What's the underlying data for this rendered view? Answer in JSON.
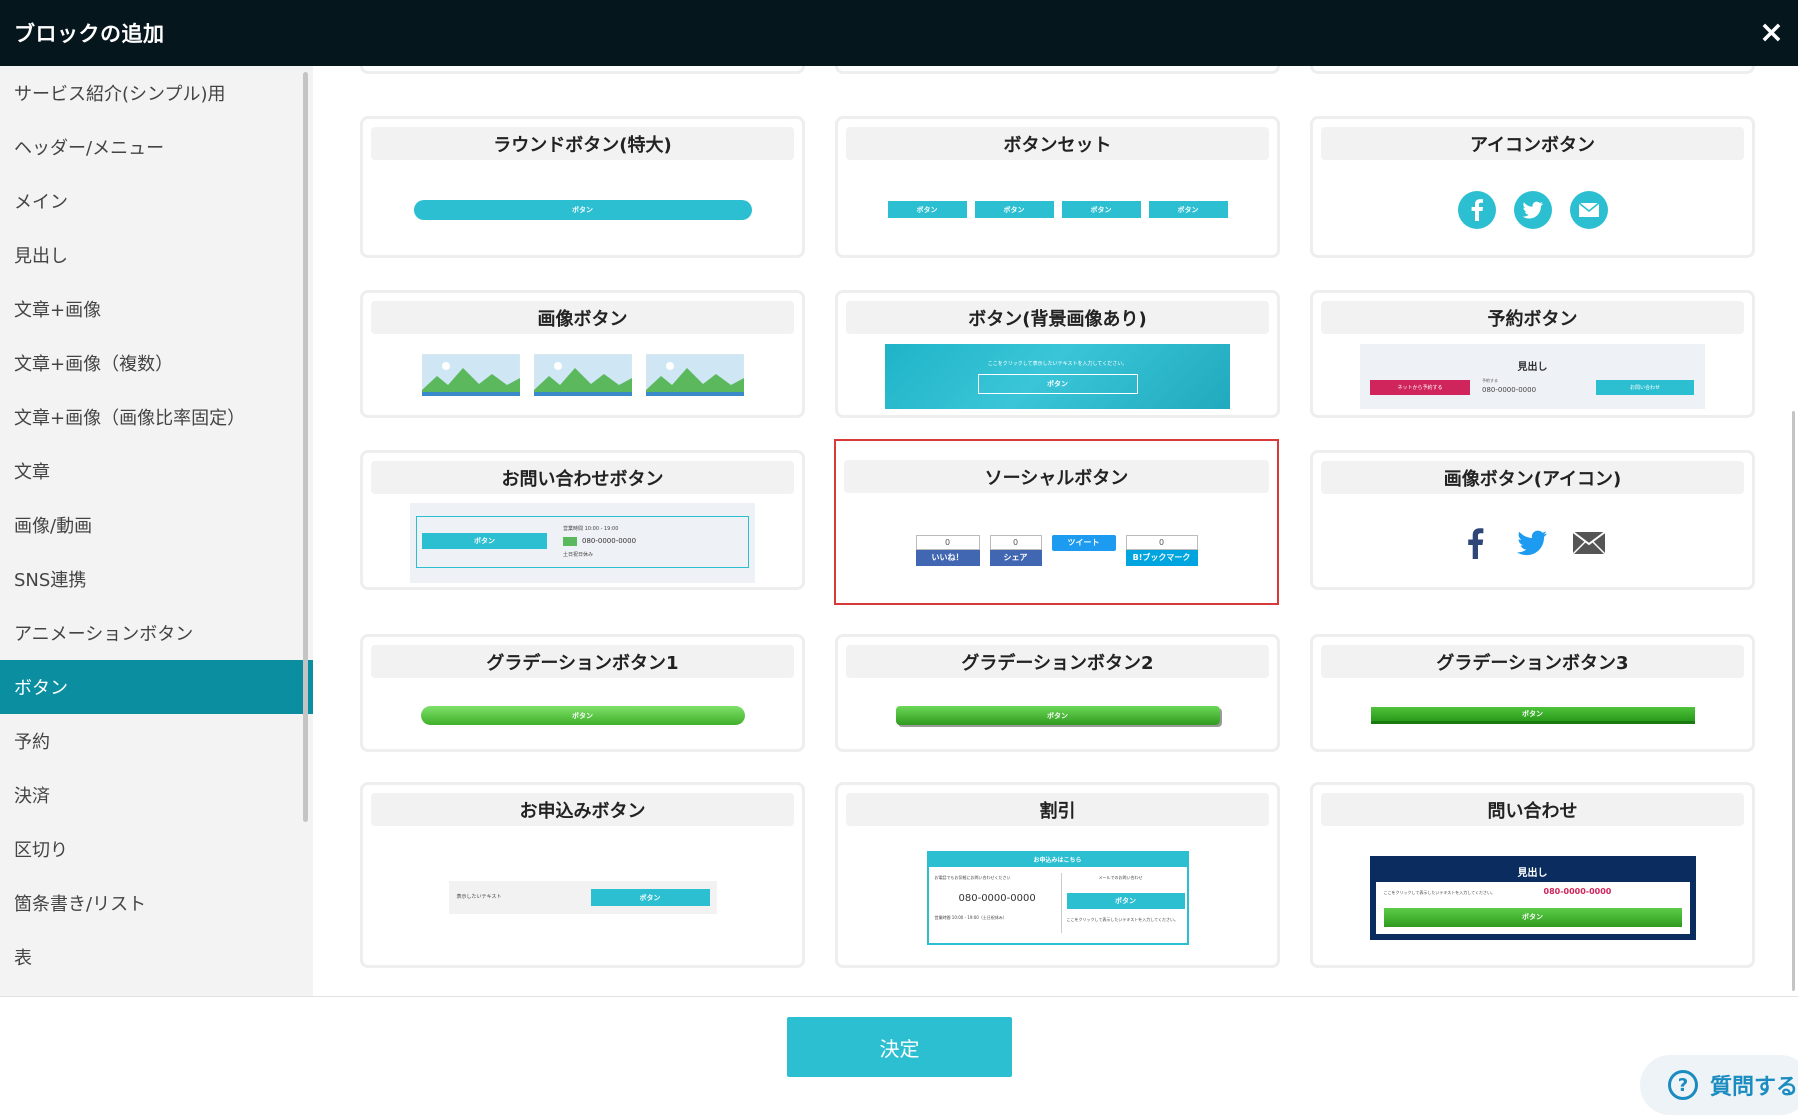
{
  "window": {
    "title": "ブロックの追加",
    "close_symbol": "×"
  },
  "sidebar": {
    "items": [
      {
        "label": "サービス紹介(シンプル)用"
      },
      {
        "label": "ヘッダー/メニュー"
      },
      {
        "label": "メイン"
      },
      {
        "label": "見出し"
      },
      {
        "label": "文章+画像"
      },
      {
        "label": "文章+画像（複数）"
      },
      {
        "label": "文章+画像（画像比率固定）"
      },
      {
        "label": "文章"
      },
      {
        "label": "画像/動画"
      },
      {
        "label": "SNS連携"
      },
      {
        "label": "アニメーションボタン"
      },
      {
        "label": "ボタン",
        "active": true
      },
      {
        "label": "予約"
      },
      {
        "label": "決済"
      },
      {
        "label": "区切り"
      },
      {
        "label": "箇条書き/リスト"
      },
      {
        "label": "表"
      }
    ]
  },
  "cards": [
    {
      "title": "ラウンドボタン(特大)",
      "button_text": "ボタン"
    },
    {
      "title": "ボタンセット",
      "button_text": "ボタン"
    },
    {
      "title": "アイコンボタン"
    },
    {
      "title": "画像ボタン"
    },
    {
      "title": "ボタン(背景画像あり)",
      "caption": "ここをクリックして表示したいテキストを入力してください。",
      "button_text": "ボタン"
    },
    {
      "title": "予約ボタン",
      "heading": "見出し",
      "net_button": "ネットから予約する",
      "tel_label": "予約する",
      "tel": "080-0000-0000",
      "contact_button": "お問い合わせ"
    },
    {
      "title": "お問い合わせボタン",
      "button_text": "ボタン",
      "hours": "営業時間 10:00 - 19:00",
      "tel": "080-0000-0000",
      "holiday": "土日祝日休み"
    },
    {
      "title": "ソーシャルボタン",
      "selected": true,
      "like_count": "0",
      "like_label": "いいね！",
      "share_count": "0",
      "share_label": "シェア",
      "tweet_label": "ツイート",
      "hatena_count": "0",
      "hatena_label": "B!ブックマーク"
    },
    {
      "title": "画像ボタン(アイコン)"
    },
    {
      "title": "グラデーションボタン1",
      "button_text": "ボタン"
    },
    {
      "title": "グラデーションボタン2",
      "button_text": "ボタン"
    },
    {
      "title": "グラデーションボタン3",
      "button_text": "ボタン"
    },
    {
      "title": "お申込みボタン",
      "text": "表示したいテキスト",
      "button_text": "ボタン"
    },
    {
      "title": "割引",
      "header": "お申込みはこちら",
      "left_caption": "お電話でもお気軽にお問い合わせください",
      "tel": "080-0000-0000",
      "hours": "営業時間 10:00 - 19:00（土日祝休み）",
      "right_caption": "メールでのお問い合わせ",
      "button_text": "ボタン",
      "note": "ここをクリックして表示したいテキストを入力してください。"
    },
    {
      "title": "問い合わせ",
      "heading": "見出し",
      "caption": "ここをクリックして表示したいテキストを入力してください。",
      "tel": "080-0000-0000",
      "button_text": "ボタン"
    }
  ],
  "footer": {
    "decide_label": "決定",
    "help_label": "質問する"
  },
  "colors": {
    "accent": "#2cbfd2",
    "sidebar_active": "#0a8ea0",
    "titlebar": "#06161d",
    "selection": "#d83a3a"
  }
}
